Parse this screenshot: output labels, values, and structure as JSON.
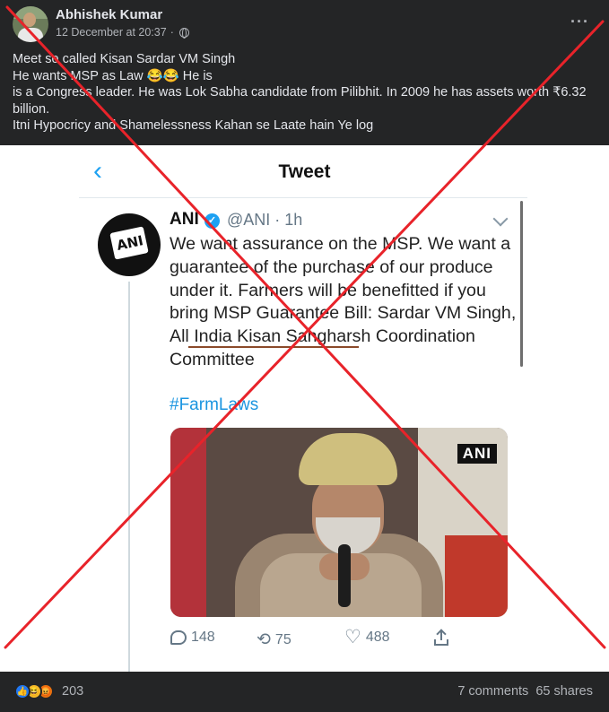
{
  "post": {
    "author": "Abhishek Kumar",
    "timestamp": "12 December at 20:37",
    "separator": "·",
    "more_label": "···",
    "text_lines": [
      "Meet so called Kisan Sardar VM Singh",
      "He wants MSP as Law 😂😂 He is",
      "is a Congress leader. He was Lok Sabha candidate from Pilibhit. In 2009 he has assets worth ₹6.32 billion.",
      "Itni Hypocricy and Shamelessness Kahan se Laate hain Ye log"
    ]
  },
  "tweet": {
    "back_glyph": "‹",
    "header_title": "Tweet",
    "name": "ANI",
    "verified_glyph": "✓",
    "handle_time": "@ANI · 1h",
    "avatar_text": "ANI",
    "body": "We want assurance on the MSP. We want a guarantee of the purchase of our produce under it. Farmers will be benefitted if you bring MSP Guarantee Bill: Sardar VM Singh, All India Kisan Sangharsh Coordination Committee",
    "hashtag": "#FarmLaws",
    "media_watermark": "ANI",
    "replies": "148",
    "retweets": "75",
    "likes": "488",
    "retweet_glyph": "⟲",
    "like_glyph": "♡"
  },
  "overlay": {
    "cross_color": "#e8232a"
  },
  "footer": {
    "reaction_count": "203",
    "comments": "7 comments",
    "shares": "65 shares",
    "like_glyph": "👍",
    "haha_glyph": "😆",
    "angry_glyph": "😡"
  }
}
